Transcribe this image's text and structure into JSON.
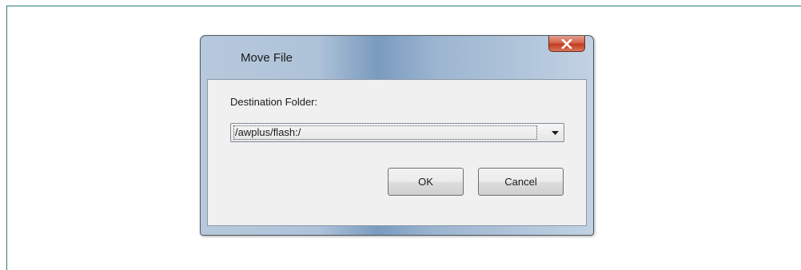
{
  "dialog": {
    "title": "Move File",
    "close_icon": "close-x-icon",
    "destination_label": "Destination Folder:",
    "destination_value": "/awplus/flash:/",
    "dropdown_icon": "chevron-down-icon",
    "ok_label": "OK",
    "cancel_label": "Cancel"
  },
  "colors": {
    "close_button": "#c23d22",
    "client_background": "#f0f0f0",
    "frame_line": "#2e7d78"
  }
}
